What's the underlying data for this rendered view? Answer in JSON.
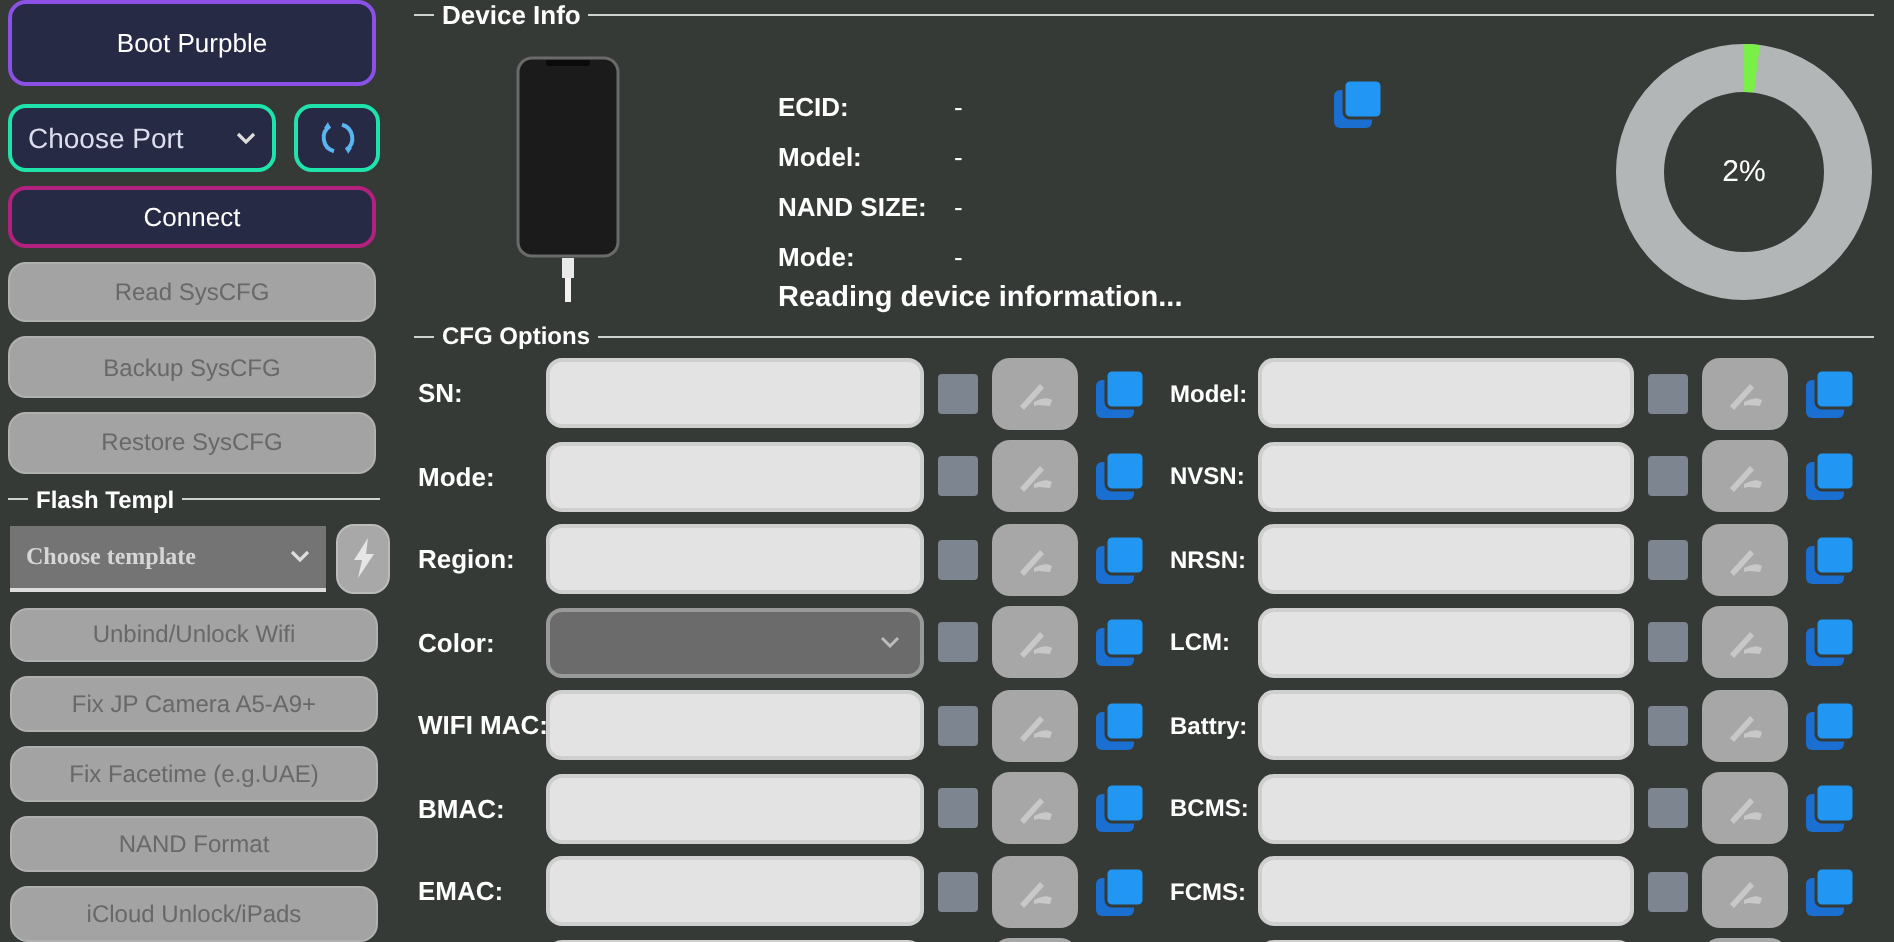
{
  "sidebar": {
    "boot_button": {
      "label": "Boot Purpble",
      "kind": "purple"
    },
    "port_select": {
      "value": "Choose Port"
    },
    "connect_button": {
      "label": "Connect",
      "kind": "magenta"
    },
    "actions": [
      {
        "label": "Read SysCFG",
        "disabled": true
      },
      {
        "label": "Backup SysCFG",
        "disabled": true
      },
      {
        "label": "Restore SysCFG",
        "disabled": true
      }
    ],
    "flash_template": {
      "legend": "Flash Templ",
      "select": {
        "value": "Choose template"
      },
      "flash_disabled": true
    },
    "tools": [
      {
        "label": "Unbind/Unlock Wifi",
        "disabled": true
      },
      {
        "label": "Fix JP Camera A5-A9+",
        "disabled": true
      },
      {
        "label": "Fix Facetime (e.g.UAE)",
        "disabled": true
      },
      {
        "label": "NAND Format",
        "disabled": true
      },
      {
        "label": "iCloud Unlock/iPads",
        "disabled": true
      }
    ]
  },
  "device_info": {
    "legend": "Device Info",
    "fields": [
      {
        "label": "ECID:",
        "value": "-"
      },
      {
        "label": "Model:",
        "value": "-"
      },
      {
        "label": "NAND SIZE:",
        "value": "-"
      },
      {
        "label": "Mode:",
        "value": "-"
      }
    ],
    "status": "Reading device information...",
    "progress": {
      "level": 0.02,
      "reading": "2%"
    }
  },
  "cfg_options": {
    "legend": "CFG Options",
    "left": [
      {
        "label": "SN:",
        "kind": "text",
        "checked": false
      },
      {
        "label": "Mode:",
        "kind": "text",
        "checked": false
      },
      {
        "label": "Region:",
        "kind": "text",
        "checked": false
      },
      {
        "label": "Color:",
        "kind": "select",
        "checked": false
      },
      {
        "label": "WIFI MAC:",
        "kind": "text",
        "checked": false
      },
      {
        "label": "BMAC:",
        "kind": "text",
        "checked": false
      },
      {
        "label": "EMAC:",
        "kind": "text",
        "checked": false
      },
      {
        "kind": "text"
      }
    ],
    "right": [
      {
        "label": "Model:",
        "kind": "text",
        "checked": false
      },
      {
        "label": "NVSN:",
        "kind": "text",
        "checked": false
      },
      {
        "label": "NRSN:",
        "kind": "text",
        "checked": false
      },
      {
        "label": "LCM:",
        "kind": "text",
        "checked": false
      },
      {
        "label": "Battry:",
        "kind": "text",
        "checked": false
      },
      {
        "label": "BCMS:",
        "kind": "text",
        "checked": false
      },
      {
        "label": "FCMS:",
        "kind": "text",
        "checked": false
      },
      {
        "kind": "text"
      }
    ]
  }
}
